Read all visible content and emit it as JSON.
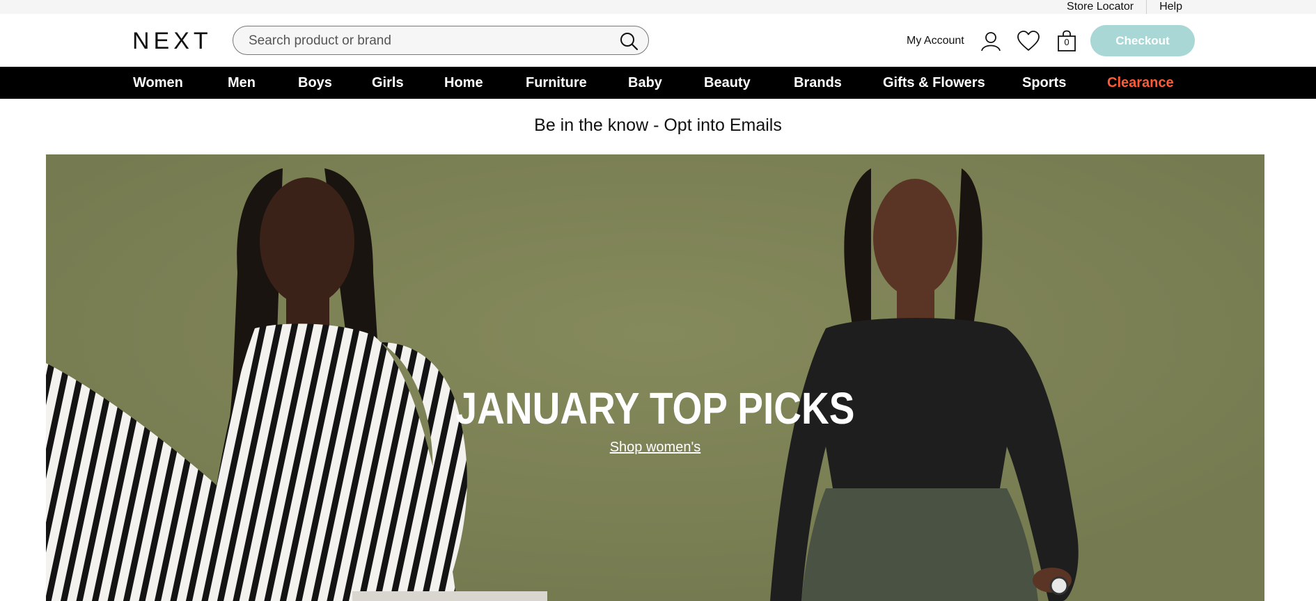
{
  "utility": {
    "store_locator": "Store Locator",
    "help": "Help"
  },
  "header": {
    "logo": "NEXT",
    "search_placeholder": "Search product or brand",
    "account_label": "My Account",
    "bag_count": "0",
    "checkout_label": "Checkout",
    "checkout_color": "#a9d7d5"
  },
  "nav": {
    "items": [
      "Women",
      "Men",
      "Boys",
      "Girls",
      "Home",
      "Furniture",
      "Baby",
      "Beauty",
      "Brands",
      "Gifts & Flowers",
      "Sports",
      "Clearance"
    ],
    "clearance_color": "#ff5a36"
  },
  "promo": {
    "text": "Be in the know - Opt into Emails"
  },
  "hero": {
    "title": "JANUARY TOP PICKS",
    "link": "Shop women's",
    "background_color": "#7f8257"
  },
  "icons": {
    "search": "search-icon",
    "user": "user-icon",
    "wishlist": "heart-icon",
    "bag": "shopping-bag-icon"
  }
}
